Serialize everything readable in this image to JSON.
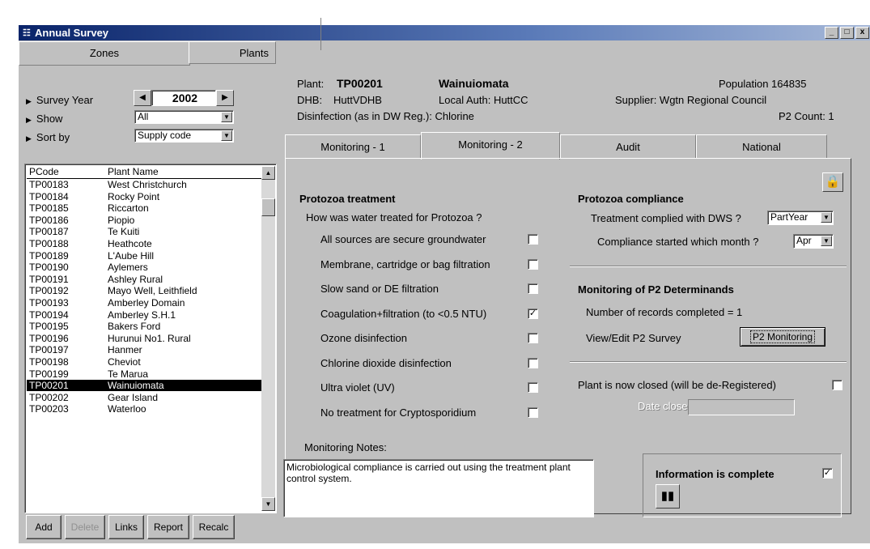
{
  "window": {
    "title": "Annual Survey",
    "controls": [
      "_",
      "□",
      "x"
    ]
  },
  "zone_tabs": {
    "zones": "Zones",
    "plants": "Plants"
  },
  "filters": {
    "survey_year_label": "Survey Year",
    "survey_year_value": "2002",
    "show_label": "Show",
    "show_value": "All",
    "sort_label": "Sort by",
    "sort_value": "Supply code"
  },
  "plant_list": {
    "headers": [
      "PCode",
      "Plant Name"
    ],
    "rows": [
      [
        "TP00183",
        "West Christchurch"
      ],
      [
        "TP00184",
        "Rocky Point"
      ],
      [
        "TP00185",
        "Riccarton"
      ],
      [
        "TP00186",
        "Piopio"
      ],
      [
        "TP00187",
        "Te Kuiti"
      ],
      [
        "TP00188",
        "Heathcote"
      ],
      [
        "TP00189",
        "L'Aube Hill"
      ],
      [
        "TP00190",
        "Aylemers"
      ],
      [
        "TP00191",
        "Ashley Rural"
      ],
      [
        "TP00192",
        "Mayo Well, Leithfield"
      ],
      [
        "TP00193",
        "Amberley Domain"
      ],
      [
        "TP00194",
        "Amberley S.H.1"
      ],
      [
        "TP00195",
        "Bakers Ford"
      ],
      [
        "TP00196",
        "Hurunui No1. Rural"
      ],
      [
        "TP00197",
        "Hanmer"
      ],
      [
        "TP00198",
        "Cheviot"
      ],
      [
        "TP00199",
        "Te Marua"
      ],
      [
        "TP00201",
        "Wainuiomata"
      ],
      [
        "TP00202",
        "Gear Island"
      ],
      [
        "TP00203",
        "Waterloo"
      ]
    ],
    "selected_index": 17
  },
  "list_buttons": {
    "add": "Add",
    "delete": "Delete",
    "links": "Links",
    "report": "Report",
    "recalc": "Recalc"
  },
  "plant_info": {
    "plant_label": "Plant:",
    "plant_code": "TP00201",
    "plant_name": "Wainuiomata",
    "population": "Population  164835",
    "dhb_label": "DHB:",
    "dhb_value": "HuttVDHB",
    "local_auth": "Local Auth:  HuttCC",
    "supplier": "Supplier:  Wgtn Regional Council",
    "disinfection": "Disinfection (as in DW Reg.):  Chlorine",
    "p2count": "P2 Count:  1"
  },
  "tabs": [
    "Monitoring - 1",
    "Monitoring - 2",
    "Audit",
    "National"
  ],
  "active_tab": 1,
  "protozoa_treatment": {
    "title": "Protozoa treatment",
    "question": "How was water treated for Protozoa ?",
    "options": [
      {
        "label": "All sources are secure groundwater",
        "checked": false
      },
      {
        "label": "Membrane, cartridge or bag filtration",
        "checked": false
      },
      {
        "label": "Slow sand or DE filtration",
        "checked": false
      },
      {
        "label": "Coagulation+filtration (to <0.5 NTU)",
        "checked": true
      },
      {
        "label": "Ozone disinfection",
        "checked": false
      },
      {
        "label": "Chlorine dioxide disinfection",
        "checked": false
      },
      {
        "label": "Ultra violet (UV)",
        "checked": false
      },
      {
        "label": "No treatment for Cryptosporidium",
        "checked": false
      }
    ]
  },
  "protozoa_compliance": {
    "title": "Protozoa compliance",
    "complied_label": "Treatment complied with DWS ?",
    "complied_value": "PartYear",
    "month_label": "Compliance started which month ?",
    "month_value": "Apr"
  },
  "p2": {
    "title": "Monitoring of P2 Determinands",
    "records": "Number of records completed =  1",
    "view_edit": "View/Edit P2 Survey",
    "button": "P2 Monitoring"
  },
  "closure": {
    "closed_label": "Plant is now closed (will be de-Registered)",
    "closed_checked": false,
    "date_label": "Date closed"
  },
  "notes": {
    "label": "Monitoring Notes:",
    "text": "Microbiological compliance is carried out using the treatment plant control system."
  },
  "info": {
    "label": "Information is complete",
    "checked": true
  },
  "icons": {
    "lock": "lock-icon",
    "book": "book-icon"
  }
}
